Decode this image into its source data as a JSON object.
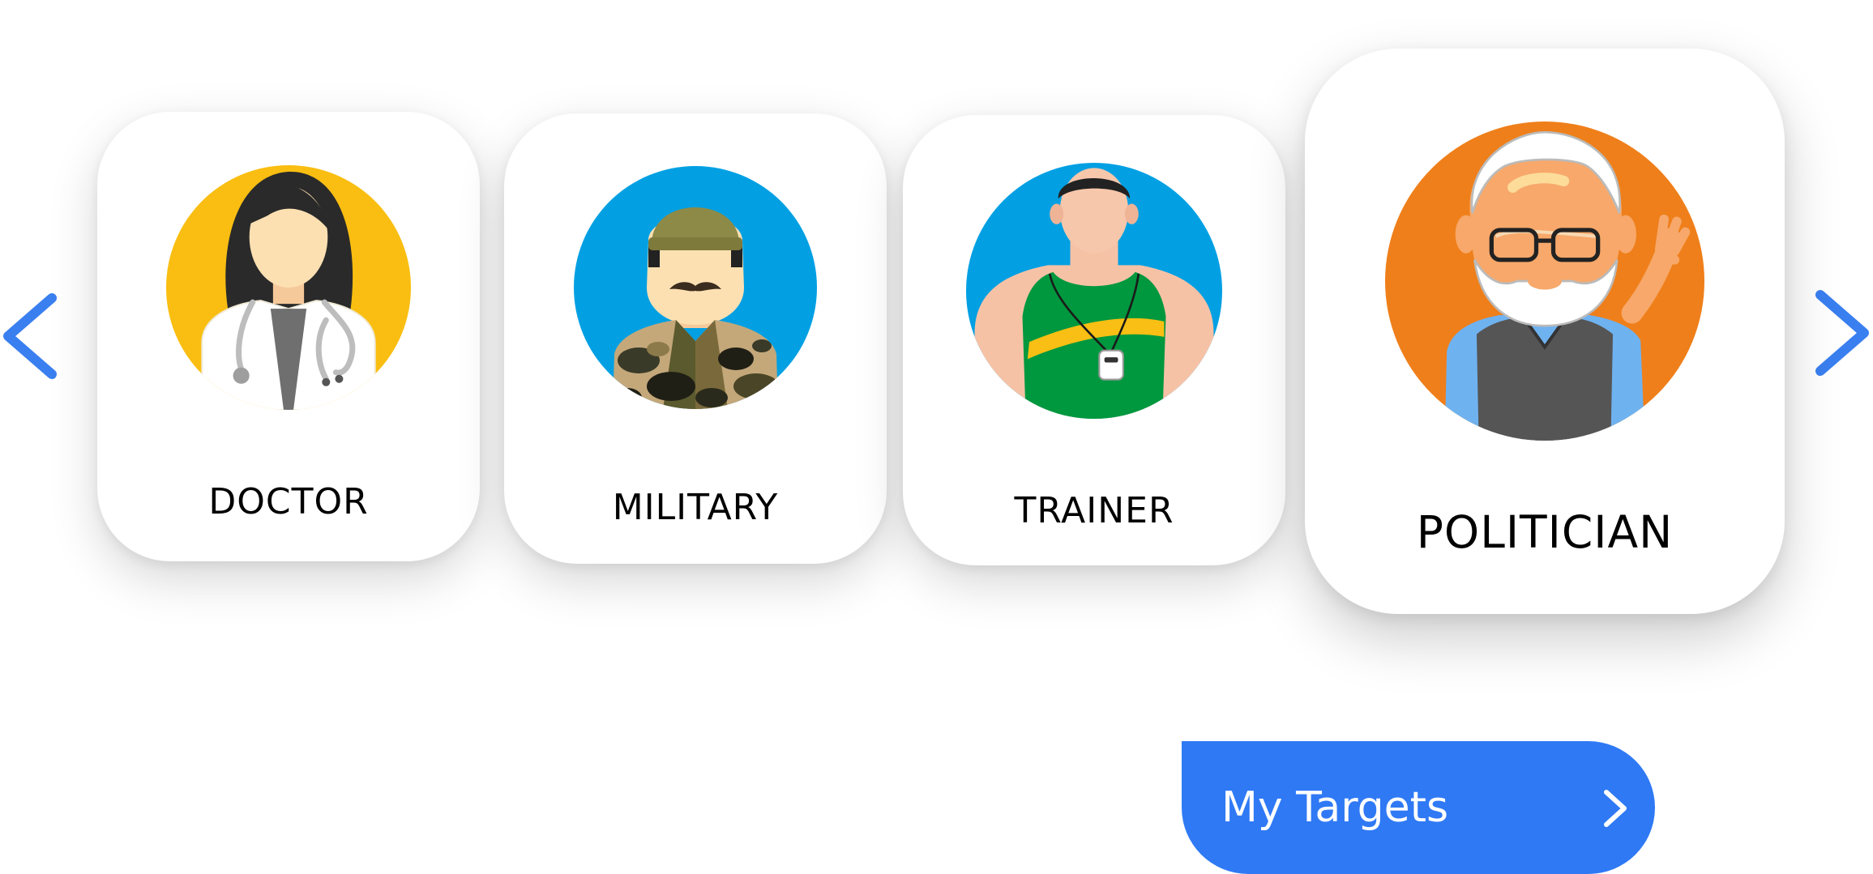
{
  "carousel": {
    "prev_icon": "chevron-left-icon",
    "next_icon": "chevron-right-icon",
    "accent_color": "#3a7ff0",
    "items": [
      {
        "label": "DOCTOR",
        "icon": "doctor-avatar-icon",
        "circle_color": "#f9be11",
        "selected": false
      },
      {
        "label": "MILITARY",
        "icon": "military-avatar-icon",
        "circle_color": "#02a0e3",
        "selected": false
      },
      {
        "label": "TRAINER",
        "icon": "trainer-avatar-icon",
        "circle_color": "#02a0e3",
        "selected": false
      },
      {
        "label": "POLITICIAN",
        "icon": "politician-avatar-icon",
        "circle_color": "#ef7f1a",
        "selected": true
      }
    ]
  },
  "action": {
    "label": "My Targets",
    "icon": "chevron-right-icon",
    "color": "#2f79f5"
  }
}
